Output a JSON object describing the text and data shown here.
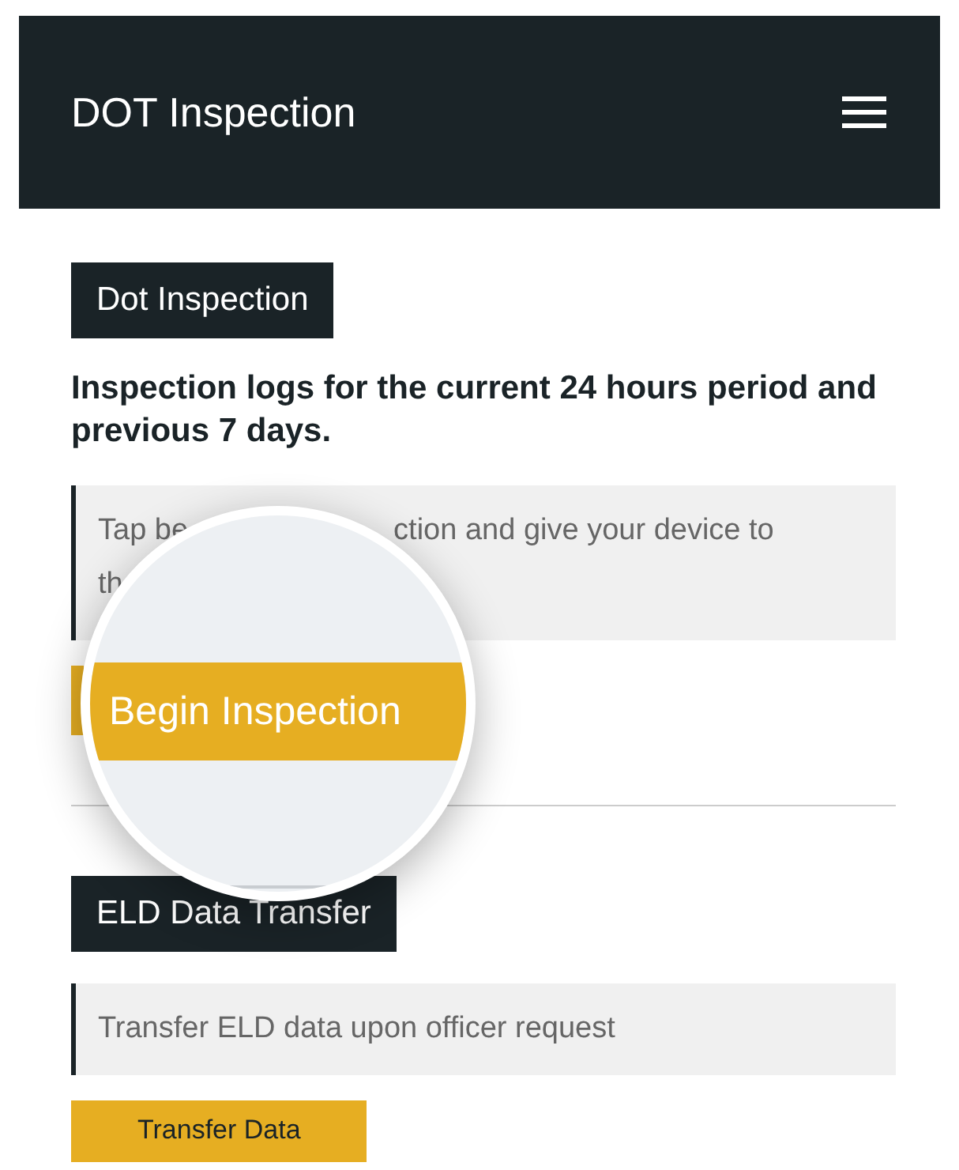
{
  "app_bar": {
    "title": "DOT Inspection"
  },
  "inspection": {
    "label": "Dot Inspection",
    "heading": "Inspection logs for the current 24 hours period and previous 7 days.",
    "note_fragments": [
      [
        "Tap be",
        "ction and give your device to"
      ],
      [
        "th"
      ]
    ]
  },
  "magnifier": {
    "button": "Begin Inspection"
  },
  "transfer": {
    "label": "ELD Data Transfer",
    "note": "Transfer ELD data upon officer request",
    "button": "Transfer Data"
  }
}
